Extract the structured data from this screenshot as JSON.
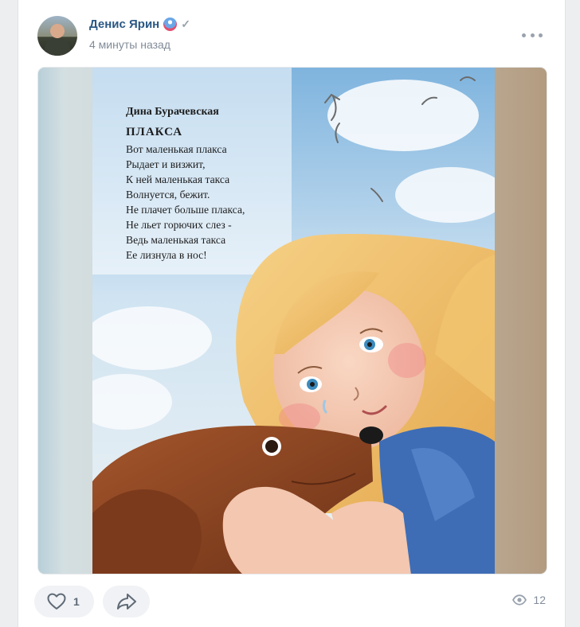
{
  "post": {
    "author": "Денис Ярин",
    "timestamp": "4 минуты назад",
    "icons": {
      "badge": "emoji-badge-icon",
      "verified": "check-icon",
      "more": "more-horizontal-icon"
    }
  },
  "image": {
    "poet": "Дина Бурачевская",
    "title": "ПЛАКСА",
    "lines": [
      "Вот маленькая плакса",
      "Рыдает и визжит,",
      "К ней маленькая такса",
      "Волнуется, бежит.",
      "Не плачет больше плакса,",
      "Не льет горючих слез -",
      "Ведь маленькая такса",
      "Ее лизнула в нос!"
    ]
  },
  "actions": {
    "likes": "1",
    "views": "12",
    "icons": {
      "like": "heart-icon",
      "share": "share-icon",
      "views": "eye-icon"
    }
  },
  "colors": {
    "author": "#2a5885",
    "muted": "#818c99",
    "pill": "#f0f2f5",
    "background": "#edeef0"
  }
}
